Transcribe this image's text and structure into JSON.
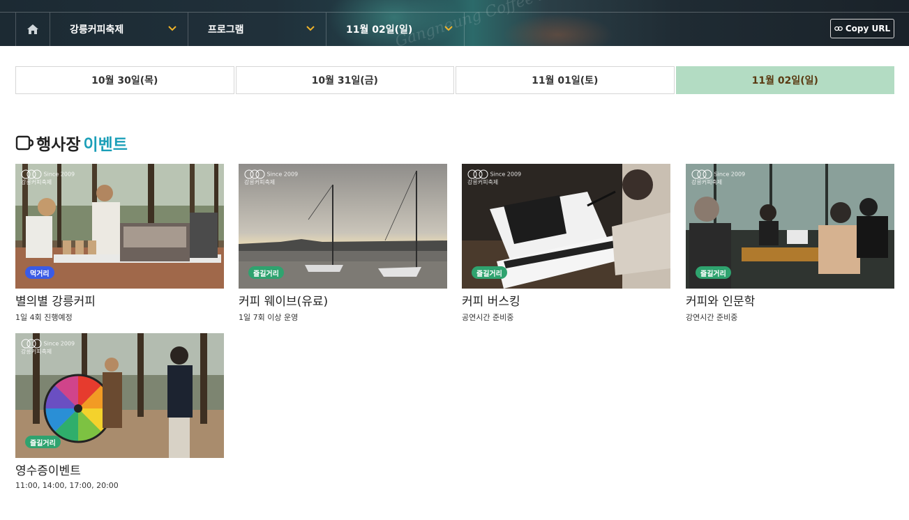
{
  "nav": {
    "home_icon": "home-icon",
    "dropdowns": [
      {
        "label": "강릉커피축제"
      },
      {
        "label": "프로그램"
      },
      {
        "label": "11월 02일(일)"
      }
    ],
    "copy_url_label": "Copy URL",
    "link_icon": "link-icon",
    "chevron_color": "#f0b429",
    "banner_text": "Gangneung Coffee Festival"
  },
  "date_tabs": [
    {
      "label": "10월 30일(목)",
      "active": false
    },
    {
      "label": "10월 31일(금)",
      "active": false
    },
    {
      "label": "11월 01일(토)",
      "active": false
    },
    {
      "label": "11월 02일(일)",
      "active": true
    }
  ],
  "active_tab_color": "#b3dcc3",
  "section": {
    "icon": "cup-icon",
    "title_main": "행사장",
    "title_accent": "이벤트",
    "accent_color": "#1b9fb8"
  },
  "logo": {
    "since": "Since 2009",
    "name": "강릉커피축제"
  },
  "events": [
    {
      "badge": "먹거리",
      "badge_color": "#3a5be6",
      "title": "별의별 강릉커피",
      "subtitle": "1일 4회 진행예정",
      "image": "coffee-booth-photo"
    },
    {
      "badge": "즐길거리",
      "badge_color": "#2fa36f",
      "title": "커피 웨이브(유료)",
      "subtitle": "1일 7회 이상 운영",
      "image": "sailboat-photo"
    },
    {
      "badge": "즐길거리",
      "badge_color": "#2fa36f",
      "title": "커피 버스킹",
      "subtitle": "공연시간 준비중",
      "image": "piano-busking-photo"
    },
    {
      "badge": "즐길거리",
      "badge_color": "#2fa36f",
      "title": "커피와 인문학",
      "subtitle": "강연시간 준비중",
      "image": "lecture-cafe-photo"
    },
    {
      "badge": "즐길거리",
      "badge_color": "#2fa36f",
      "title": "영수증이벤트",
      "subtitle": "11:00, 14:00, 17:00, 20:00",
      "image": "roulette-event-photo"
    }
  ]
}
